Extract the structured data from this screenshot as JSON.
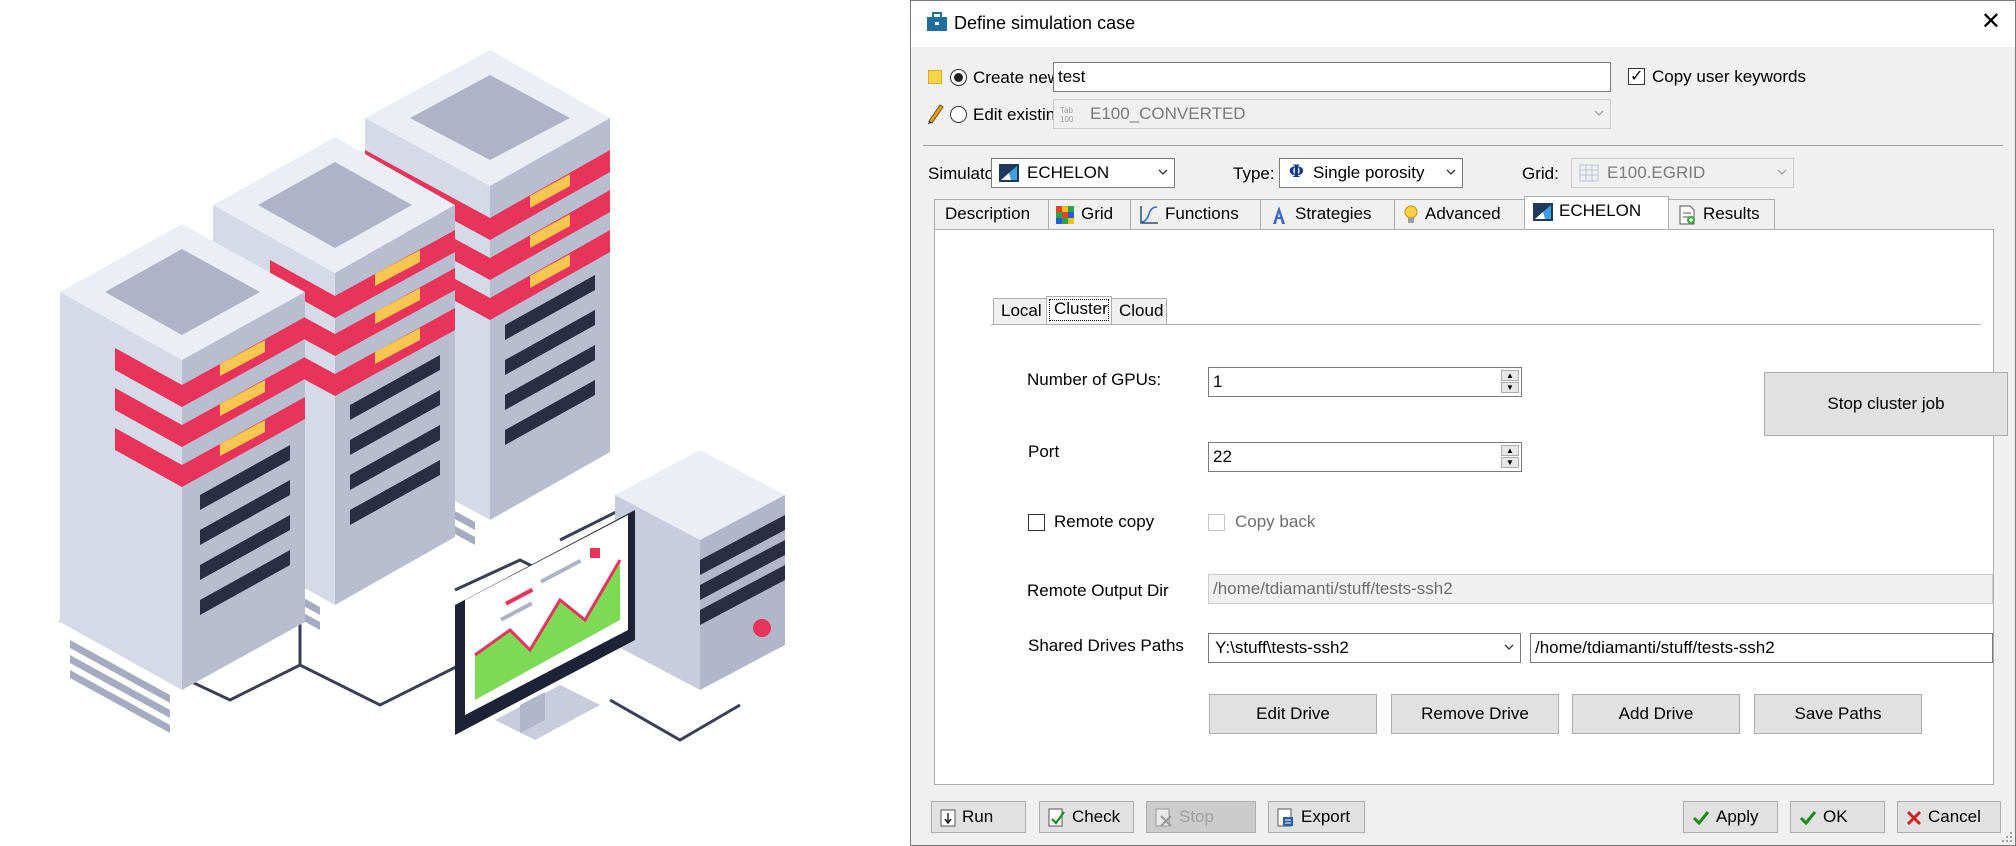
{
  "dialog": {
    "title": "Define simulation case",
    "close_glyph": "✕"
  },
  "case": {
    "create_label": "Create new:",
    "create_value": "test",
    "copy_keywords_label": "Copy user keywords",
    "edit_label": "Edit existing:",
    "edit_value": "E100_CONVERTED"
  },
  "simulator": {
    "label": "Simulator:",
    "value": "ECHELON",
    "type_label": "Type:",
    "type_value": "Single porosity",
    "grid_label": "Grid:",
    "grid_value": "E100.EGRID"
  },
  "tabs": [
    {
      "label": "Description",
      "icon": "none"
    },
    {
      "label": "Grid",
      "icon": "grid-icon"
    },
    {
      "label": "Functions",
      "icon": "functions-icon"
    },
    {
      "label": "Strategies",
      "icon": "strategies-icon"
    },
    {
      "label": "Advanced",
      "icon": "lightbulb-icon"
    },
    {
      "label": "ECHELON",
      "icon": "echelon-icon"
    },
    {
      "label": "Results",
      "icon": "results-icon"
    }
  ],
  "subtabs": [
    "Local",
    "Cluster",
    "Cloud"
  ],
  "cluster": {
    "gpus_label": "Number of GPUs:",
    "gpus_value": "1",
    "port_label": "Port",
    "port_value": "22",
    "stop_job": "Stop cluster job",
    "remote_copy_label": "Remote copy",
    "copy_back_label": "Copy back",
    "output_dir_label": "Remote Output Dir",
    "output_dir_value": "/home/tdiamanti/stuff/tests-ssh2",
    "shared_label": "Shared Drives Paths",
    "shared_drive_value": "Y:\\stuff\\tests-ssh2",
    "shared_path_value": "/home/tdiamanti/stuff/tests-ssh2",
    "edit_drive": "Edit Drive",
    "remove_drive": "Remove Drive",
    "add_drive": "Add Drive",
    "save_paths": "Save Paths"
  },
  "footer": {
    "run": "Run",
    "check": "Check",
    "stop": "Stop",
    "export": "Export",
    "apply": "Apply",
    "ok": "OK",
    "cancel": "Cancel"
  },
  "colors": {
    "server_red": "#e8335a",
    "server_yellow": "#f9c74f",
    "server_body": "#d6d9e6",
    "chart_green": "#7ed957",
    "apply_check": "#1a8a1a",
    "cancel_x": "#d42020"
  }
}
